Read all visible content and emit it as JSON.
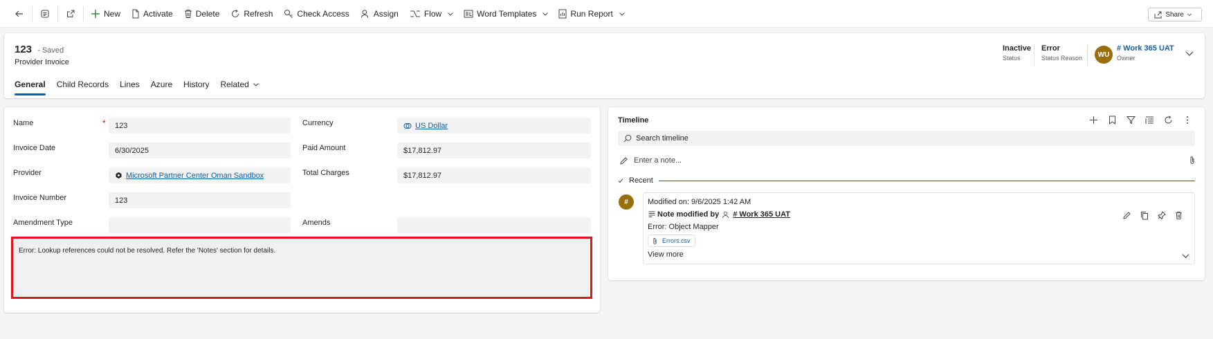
{
  "toolbar": {
    "new": "New",
    "activate": "Activate",
    "delete": "Delete",
    "refresh": "Refresh",
    "check_access": "Check Access",
    "assign": "Assign",
    "flow": "Flow",
    "word_templates": "Word Templates",
    "run_report": "Run Report",
    "share": "Share"
  },
  "header": {
    "title": "123",
    "saved_status": "- Saved",
    "entity": "Provider Invoice",
    "status_value": "Inactive",
    "status_label": "Status",
    "status_reason_value": "Error",
    "status_reason_label": "Status Reason",
    "owner_initials": "WU",
    "owner_value": "# Work 365 UAT",
    "owner_label": "Owner",
    "avatar_color": "#986f0b"
  },
  "tabs": [
    "General",
    "Child Records",
    "Lines",
    "Azure",
    "History",
    "Related"
  ],
  "form": {
    "name_label": "Name",
    "name_value": "123",
    "invoice_date_label": "Invoice Date",
    "invoice_date_value": "6/30/2025",
    "provider_label": "Provider",
    "provider_value": "Microsoft Partner Center Oman Sandbox",
    "invoice_number_label": "Invoice Number",
    "invoice_number_value": "123",
    "amendment_type_label": "Amendment Type",
    "amendment_type_value": "",
    "currency_label": "Currency",
    "currency_value": "US Dollar",
    "paid_amount_label": "Paid Amount",
    "paid_amount_value": "$17,812.97",
    "total_charges_label": "Total Charges",
    "total_charges_value": "$17,812.97",
    "amends_label": "Amends",
    "amends_value": "",
    "error_message": "Error: Lookup references could not be resolved. Refer the 'Notes' section for details.",
    "error_border_color": "#e3141c"
  },
  "timeline": {
    "title": "Timeline",
    "search_placeholder": "Search timeline",
    "note_placeholder": "Enter a note...",
    "recent_label": "Recent",
    "post": {
      "avatar_initial": "#",
      "modified": "Modified on: 9/6/2025 1:42 AM",
      "head_prefix": "Note modified by",
      "author": "# Work 365 UAT",
      "subject": "Error: Object Mapper",
      "attachment": "Errors.csv",
      "view_more": "View more"
    }
  }
}
